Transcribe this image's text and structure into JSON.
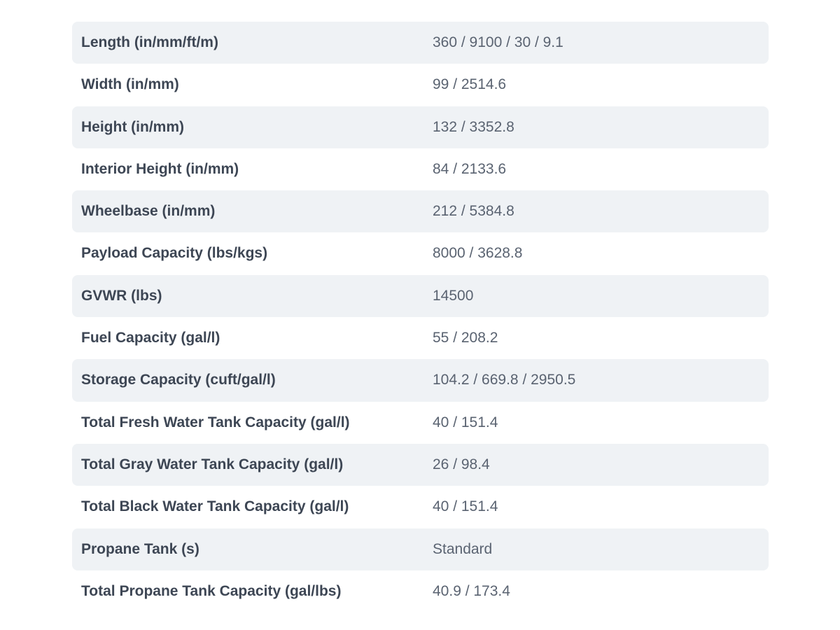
{
  "specs": [
    {
      "label": "Length (in/mm/ft/m)",
      "value": "360 / 9100 / 30 / 9.1"
    },
    {
      "label": "Width (in/mm)",
      "value": "99 / 2514.6"
    },
    {
      "label": "Height (in/mm)",
      "value": "132 / 3352.8"
    },
    {
      "label": "Interior Height (in/mm)",
      "value": "84 / 2133.6"
    },
    {
      "label": "Wheelbase (in/mm)",
      "value": "212 / 5384.8"
    },
    {
      "label": "Payload Capacity (lbs/kgs)",
      "value": "8000 / 3628.8"
    },
    {
      "label": "GVWR (lbs)",
      "value": "14500"
    },
    {
      "label": "Fuel Capacity (gal/l)",
      "value": "55 / 208.2"
    },
    {
      "label": "Storage Capacity (cuft/gal/l)",
      "value": "104.2 / 669.8 / 2950.5"
    },
    {
      "label": "Total Fresh Water Tank Capacity (gal/l)",
      "value": "40 / 151.4"
    },
    {
      "label": "Total Gray Water Tank Capacity (gal/l)",
      "value": "26 / 98.4"
    },
    {
      "label": "Total Black Water Tank Capacity (gal/l)",
      "value": "40 / 151.4"
    },
    {
      "label": "Propane Tank (s)",
      "value": "Standard"
    },
    {
      "label": "Total Propane Tank Capacity (gal/lbs)",
      "value": "40.9 / 173.4"
    }
  ]
}
